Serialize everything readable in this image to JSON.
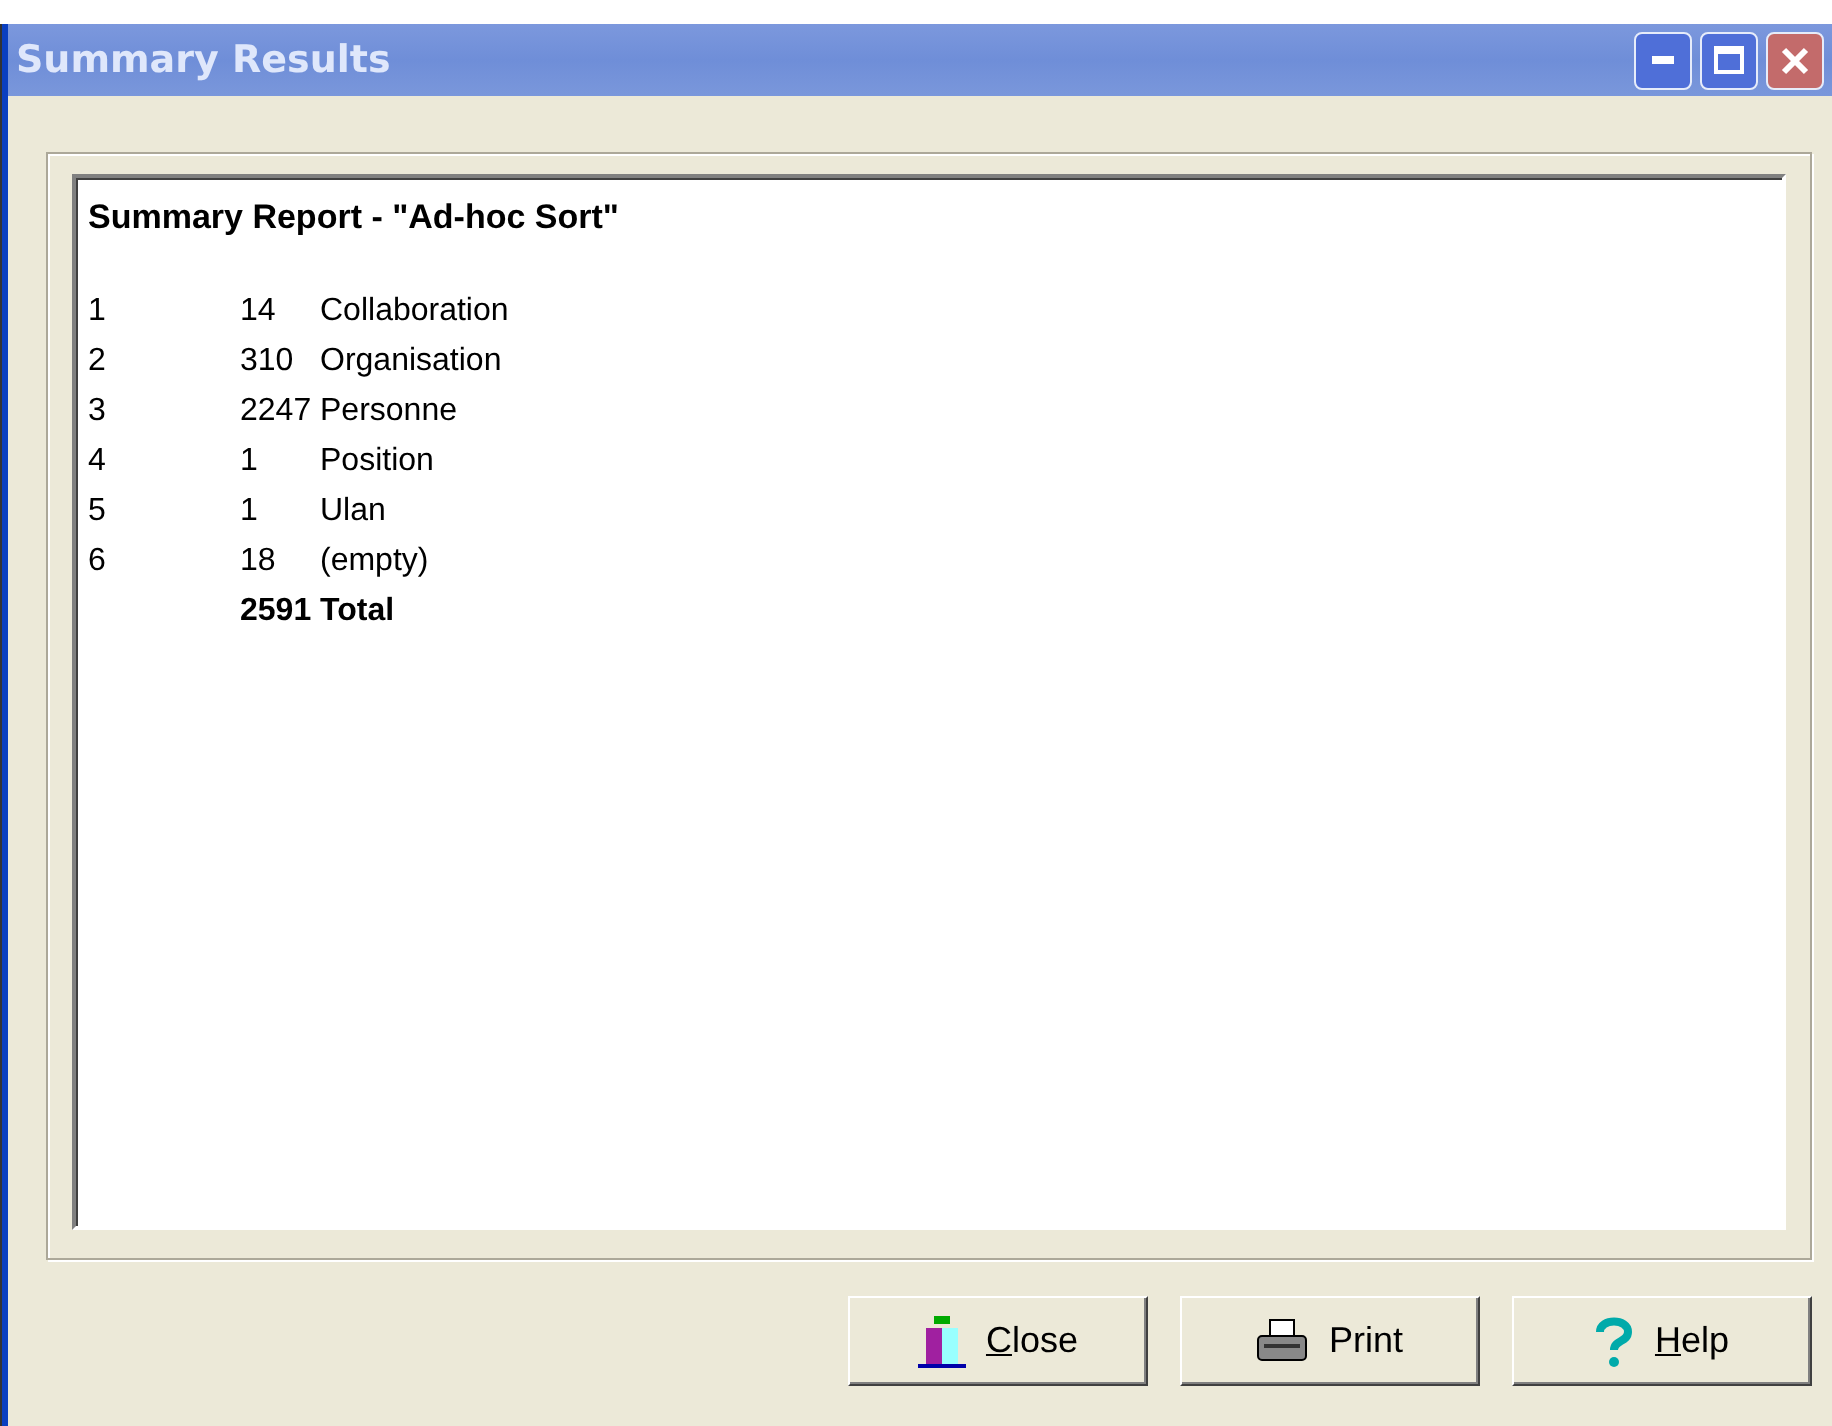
{
  "window": {
    "title": "Summary Results"
  },
  "report": {
    "heading": "Summary Report - \"Ad-hoc Sort\"",
    "rows": [
      {
        "index": "1",
        "count": "14",
        "name": "Collaboration"
      },
      {
        "index": "2",
        "count": "310",
        "name": "Organisation"
      },
      {
        "index": "3",
        "count": "2247",
        "name": "Personne"
      },
      {
        "index": "4",
        "count": "1",
        "name": "Position"
      },
      {
        "index": "5",
        "count": "1",
        "name": "Ulan"
      },
      {
        "index": "6",
        "count": "18",
        "name": "(empty)"
      }
    ],
    "total": {
      "count": "2591",
      "name": "Total"
    }
  },
  "buttons": [
    {
      "label": "Close",
      "kind": "close",
      "underline_first": true
    },
    {
      "label": "Print",
      "kind": "print",
      "underline_first": false
    },
    {
      "label": "Help",
      "kind": "help",
      "underline_first": true
    }
  ]
}
